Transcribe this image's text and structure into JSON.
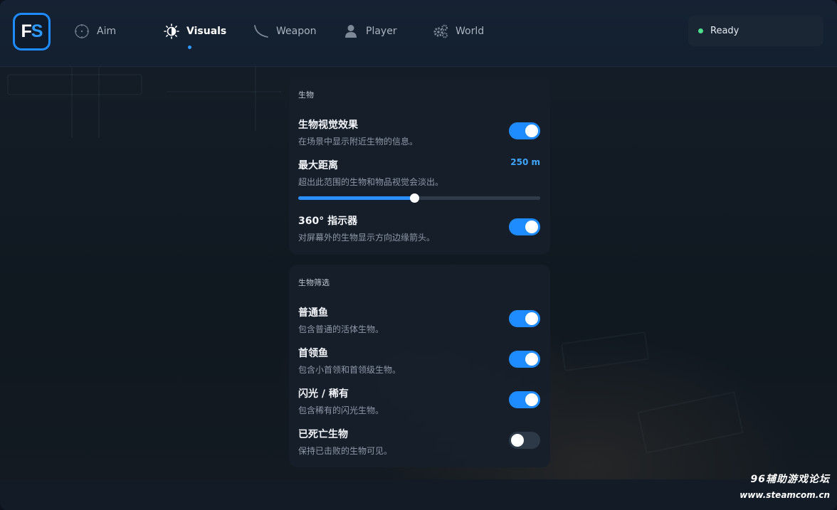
{
  "brand": {
    "logo_f": "F",
    "logo_s": "S"
  },
  "nav": {
    "tabs": [
      {
        "label": "Aim",
        "icon": "crosshair-icon",
        "active": false
      },
      {
        "label": "Visuals",
        "icon": "brightness-icon",
        "active": true
      },
      {
        "label": "Weapon",
        "icon": "fishing-rod-icon",
        "active": false
      },
      {
        "label": "Player",
        "icon": "person-icon",
        "active": false
      },
      {
        "label": "World",
        "icon": "gears-icon",
        "active": false
      }
    ]
  },
  "status": {
    "label": "Ready",
    "color": "#4ddf8e"
  },
  "creatures_panel": {
    "title": "生物",
    "visual_effects": {
      "title": "生物视觉效果",
      "desc": "在场景中显示附近生物的信息。",
      "enabled": true
    },
    "max_distance": {
      "title": "最大距离",
      "desc": "超出此范围的生物和物品视觉会淡出。",
      "value_label": "250 m",
      "fraction": 0.48
    },
    "indicator_360": {
      "title": "360° 指示器",
      "desc": "对屏幕外的生物显示方向边缘箭头。",
      "enabled": true
    }
  },
  "filter_panel": {
    "title": "生物筛选",
    "items": [
      {
        "title": "普通鱼",
        "desc": "包含普通的活体生物。",
        "enabled": true
      },
      {
        "title": "首领鱼",
        "desc": "包含小首领和首领级生物。",
        "enabled": true
      },
      {
        "title": "闪光 / 稀有",
        "desc": "包含稀有的闪光生物。",
        "enabled": true
      },
      {
        "title": "已死亡生物",
        "desc": "保持已击败的生物可见。",
        "enabled": false
      }
    ]
  },
  "watermark": {
    "line1": "96辅助游戏论坛",
    "line2": "www.steamcom.cn"
  },
  "colors": {
    "accent": "#1e8cff",
    "accent_text": "#3ea6ff",
    "panel_bg": "#161f2b",
    "topbar_bg": "#14202f"
  }
}
